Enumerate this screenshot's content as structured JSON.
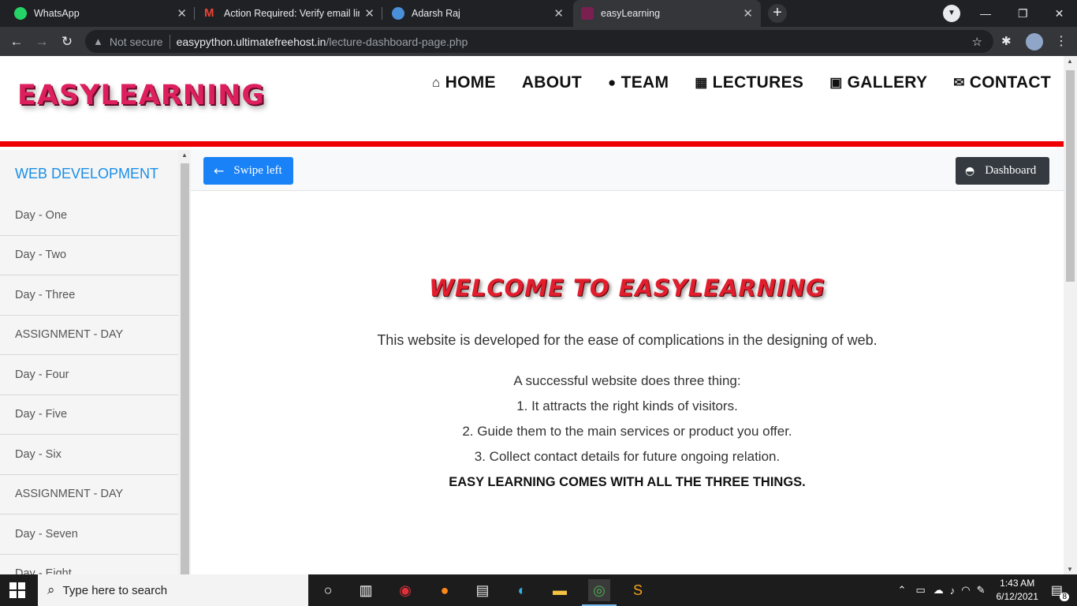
{
  "browser": {
    "tabs": [
      {
        "title": "WhatsApp",
        "icon": "whatsapp-icon",
        "color": "#25d366"
      },
      {
        "title": "Action Required: Verify email link",
        "icon": "gmail-icon",
        "color": "#ea4335"
      },
      {
        "title": "Adarsh Raj",
        "icon": "profile-icon",
        "color": "#4a90d9"
      },
      {
        "title": "easyLearning",
        "icon": "site-icon",
        "color": "#7a2050"
      }
    ],
    "security_label": "Not secure",
    "url_host": "easypython.ultimatefreehost.in",
    "url_path": "/lecture-dashboard-page.php"
  },
  "site": {
    "logo": "EASYLEARNING",
    "accent_color": "#ee0000",
    "nav": [
      {
        "label": "HOME",
        "icon": "home-icon"
      },
      {
        "label": "ABOUT",
        "icon": ""
      },
      {
        "label": "TEAM",
        "icon": "user-icon"
      },
      {
        "label": "LECTURES",
        "icon": "grid-icon"
      },
      {
        "label": "GALLERY",
        "icon": "image-icon"
      },
      {
        "label": "CONTACT",
        "icon": "envelope-icon"
      }
    ]
  },
  "sidebar": {
    "title": "WEB DEVELOPMENT",
    "items": [
      "Day - One",
      "Day - Two",
      "Day - Three",
      "ASSIGNMENT - DAY",
      "Day - Four",
      "Day - Five",
      "Day - Six",
      "ASSIGNMENT - DAY",
      "Day - Seven",
      "Day - Eight"
    ]
  },
  "main": {
    "swipe_label": "Swipe left",
    "dashboard_label": "Dashboard",
    "welcome": "WELCOME TO EASYLEARNING",
    "description": "This website is developed for the ease of complications in the designing of web.",
    "points": [
      "A successful website does three thing:",
      "1. It attracts the right kinds of visitors.",
      "2. Guide them to the main services or product you offer.",
      "3. Collect contact details for future ongoing relation."
    ],
    "closing": "EASY LEARNING COMES WITH ALL THE THREE THINGS."
  },
  "taskbar": {
    "search_placeholder": "Type here to search",
    "time": "1:43 AM",
    "date": "6/12/2021",
    "notification_count": "8"
  }
}
